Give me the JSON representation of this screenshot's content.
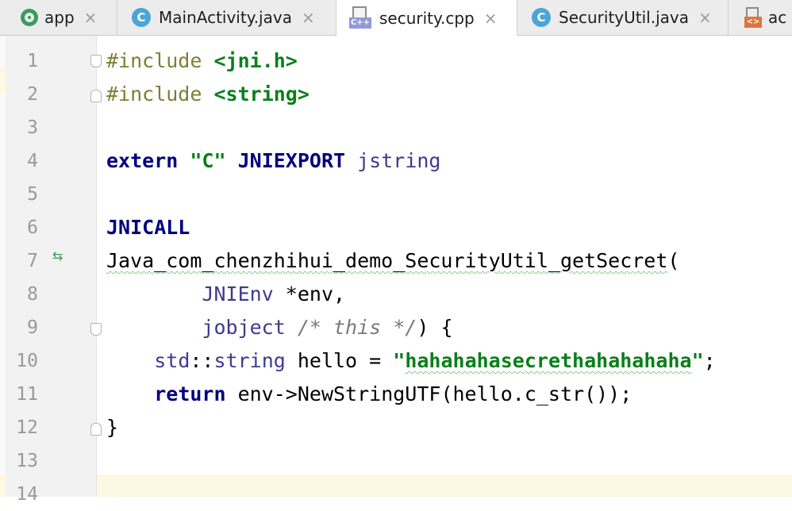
{
  "tabs": [
    {
      "label": "app",
      "icon": "app-module-icon"
    },
    {
      "label": "MainActivity.java",
      "icon": "java-class-icon",
      "icon_letter": "C"
    },
    {
      "label": "security.cpp",
      "icon": "cpp-file-icon",
      "icon_badge": "C++"
    },
    {
      "label": "SecurityUtil.java",
      "icon": "java-class-icon",
      "icon_letter": "C"
    },
    {
      "label": "ac",
      "icon": "xml-file-icon",
      "icon_badge": "<>"
    }
  ],
  "close_glyph": "×",
  "editor": {
    "line_numbers": [
      "1",
      "2",
      "3",
      "4",
      "5",
      "6",
      "7",
      "8",
      "9",
      "10",
      "11",
      "12",
      "13",
      "14"
    ],
    "code": {
      "l1_kw": "#include",
      "l1_hdr": "<jni.h>",
      "l2_kw": "#include",
      "l2_hdr": "<string>",
      "l4_extern": "extern",
      "l4_c": "\"C\"",
      "l4_export": "JNIEXPORT",
      "l4_type": "jstring",
      "l6_call": "JNICALL",
      "l7_fn": "Java_com_chenzhihui_demo_SecurityUtil_getSecret",
      "l7_paren": "(",
      "l8_type": "JNIEnv",
      "l8_rest": " *env,",
      "l9_type": "jobject",
      "l9_comment": "/* this */",
      "l9_rest": ") {",
      "l10_std": "std",
      "l10_sep": "::",
      "l10_string": "string",
      "l10_mid": " hello = ",
      "l10_q1": "\"",
      "l10_str": "hahahahasecrethahahahaha",
      "l10_q2": "\"",
      "l10_end": ";",
      "l11_return": "return",
      "l11_rest": " env->NewStringUTF(hello.c_str());",
      "l12_brace": "}"
    }
  },
  "colors": {
    "keyword": "#000080",
    "string": "#0a7f1a",
    "preprocessor": "#807d34",
    "type": "#3f3a8f",
    "comment": "#7a7a7a",
    "current_line": "#fdf8e4"
  }
}
